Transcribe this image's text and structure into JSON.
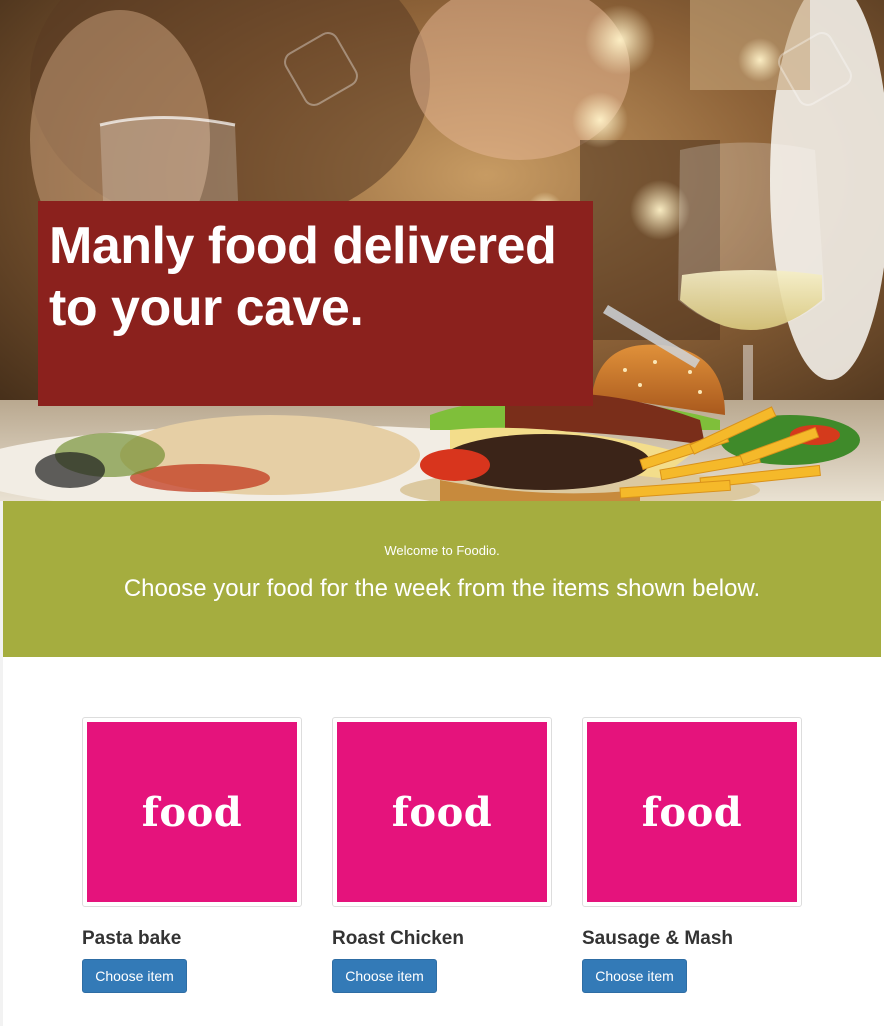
{
  "hero": {
    "title": "Manly food delivered to your cave.",
    "image_icon": "restaurant-burger-photo"
  },
  "welcome": {
    "small": "Welcome to Foodio.",
    "big": "Choose your food for the week from the items shown below."
  },
  "items": [
    {
      "image_text": "food",
      "name": "Pasta bake",
      "button": "Choose item"
    },
    {
      "image_text": "food",
      "name": "Roast Chicken",
      "button": "Choose item"
    },
    {
      "image_text": "food",
      "name": "Sausage & Mash",
      "button": "Choose item"
    }
  ],
  "colors": {
    "title_box": "#8b211d",
    "welcome_band": "#a5ad3f",
    "food_tile": "#e5137c",
    "button": "#337ab7"
  }
}
